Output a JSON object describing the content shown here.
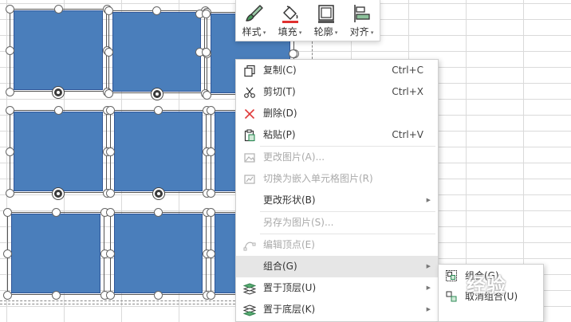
{
  "toolbar": {
    "style_label": "样式",
    "fill_label": "填充",
    "outline_label": "轮廓",
    "align_label": "对齐"
  },
  "menu": {
    "items": [
      {
        "label": "复制(C)",
        "shortcut": "Ctrl+C",
        "icon": "copy-icon",
        "disabled": false
      },
      {
        "label": "剪切(T)",
        "shortcut": "Ctrl+X",
        "icon": "scissors-icon",
        "disabled": false
      },
      {
        "label": "删除(D)",
        "shortcut": "",
        "icon": "delete-x-icon",
        "disabled": false
      },
      {
        "label": "粘贴(P)",
        "shortcut": "Ctrl+V",
        "icon": "paste-icon",
        "disabled": false
      },
      {
        "label": "更改图片(A)...",
        "shortcut": "",
        "icon": "change-picture-icon",
        "disabled": true
      },
      {
        "label": "切换为嵌入单元格图片(R)",
        "shortcut": "",
        "icon": "embed-cell-picture-icon",
        "disabled": true
      },
      {
        "label": "更改形状(B)",
        "shortcut": "",
        "icon": "",
        "disabled": false
      },
      {
        "label": "另存为图片(S)...",
        "shortcut": "",
        "icon": "",
        "disabled": true
      },
      {
        "label": "编辑顶点(E)",
        "shortcut": "",
        "icon": "edit-points-icon",
        "disabled": true
      },
      {
        "label": "组合(G)",
        "shortcut": "",
        "icon": "",
        "disabled": false
      },
      {
        "label": "置于顶层(U)",
        "shortcut": "",
        "icon": "bring-to-front-icon",
        "disabled": false
      },
      {
        "label": "置于底层(K)",
        "shortcut": "",
        "icon": "send-to-back-icon",
        "disabled": false
      }
    ]
  },
  "submenu": {
    "items": [
      {
        "label": "组合(G)",
        "icon": "group-icon"
      },
      {
        "label": "取消组合(U)",
        "icon": "ungroup-icon"
      }
    ]
  },
  "watermark": {
    "text": "经验"
  },
  "colors": {
    "shape_fill": "#4a7ebb",
    "shape_border": "#2f5597",
    "menu_highlight": "#e6e6e6",
    "delete_red": "#e03a3a",
    "fill_underline": "#e0302f"
  }
}
